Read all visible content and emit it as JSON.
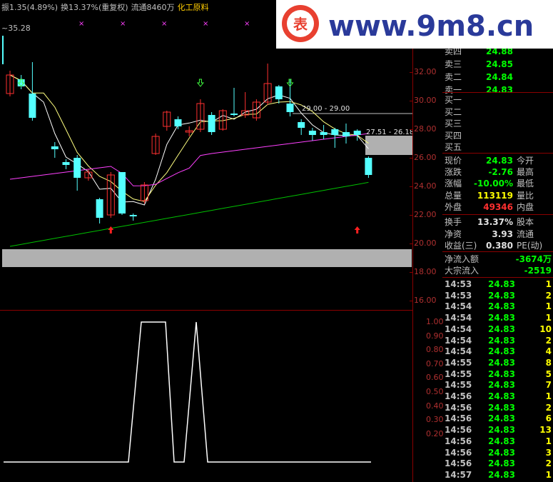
{
  "header": {
    "amplitude": "振1.35(4.89%)",
    "turnover": "换13.37%(重复权)",
    "float": "流通8460万",
    "sector": "化工原料",
    "price_marker": "~35.28"
  },
  "watermark": {
    "text": "www.9m8.cn",
    "seal": "表"
  },
  "chart_data": {
    "type": "candlestick",
    "price_axis": [
      "32.00",
      "30.00",
      "28.00",
      "26.00",
      "24.00",
      "22.00",
      "20.00",
      "18.00",
      "16.00"
    ],
    "annotations": [
      "29.00 - 29.00",
      "27.51 - 26.18"
    ],
    "indicator_axis": [
      "1.00",
      "0.90",
      "0.80",
      "0.70",
      "0.60",
      "0.50",
      "0.40",
      "0.30",
      "0.20"
    ],
    "candles": [
      {
        "o": 30.5,
        "c": 31.8,
        "h": 32.1,
        "l": 30.3
      },
      {
        "o": 31.5,
        "c": 31.0,
        "h": 31.8,
        "l": 30.8
      },
      {
        "o": 30.5,
        "c": 28.8,
        "h": 32.7,
        "l": 28.6
      },
      {
        "o": null,
        "c": null
      },
      {
        "o": 26.8,
        "c": 26.6,
        "h": 27.1,
        "l": 26.0
      },
      {
        "o": 25.7,
        "c": 25.5,
        "h": 25.9,
        "l": 25.2
      },
      {
        "o": 26.0,
        "c": 24.6,
        "h": 26.2,
        "l": 23.7
      },
      {
        "o": 24.6,
        "c": 25.0,
        "h": 25.2,
        "l": 24.4
      },
      {
        "o": 23.1,
        "c": 21.8,
        "h": 23.2,
        "l": 21.4
      },
      {
        "o": 22.0,
        "c": 24.8,
        "h": 25.0,
        "l": 21.8
      },
      {
        "o": 25.0,
        "c": 22.1,
        "h": 25.0,
        "l": 22.0
      },
      {
        "o": 22.0,
        "c": 21.9,
        "h": 22.1,
        "l": 21.6
      },
      {
        "o": 23.0,
        "c": 24.1,
        "h": 24.3,
        "l": 22.8
      },
      {
        "o": 26.3,
        "c": 27.5,
        "h": 27.7,
        "l": 26.2
      },
      {
        "o": 28.2,
        "c": 29.2,
        "h": 29.3,
        "l": 27.9
      },
      {
        "o": 28.7,
        "c": 28.2,
        "h": 28.9,
        "l": 28.0
      },
      {
        "o": 27.8,
        "c": 27.9,
        "h": 28.2,
        "l": 27.5
      },
      {
        "o": 28.0,
        "c": 29.8,
        "h": 30.1,
        "l": 27.8
      },
      {
        "o": 29.0,
        "c": 27.8,
        "h": 29.2,
        "l": 27.6
      },
      {
        "o": 28.0,
        "c": 29.3,
        "h": 29.4,
        "l": 27.9
      },
      {
        "o": 29.1,
        "c": 29.0,
        "h": 30.9,
        "l": 28.9
      },
      {
        "o": 29.0,
        "c": 29.3,
        "h": 30.6,
        "l": 28.8
      },
      {
        "o": 28.8,
        "c": 29.9,
        "h": 30.1,
        "l": 28.6
      },
      {
        "o": 29.9,
        "c": 31.2,
        "h": 32.6,
        "l": 29.7
      },
      {
        "o": 31.0,
        "c": 30.1,
        "h": 31.1,
        "l": 29.8
      },
      {
        "o": 29.8,
        "c": 29.2,
        "h": 31.5,
        "l": 28.9
      },
      {
        "o": 28.5,
        "c": 28.1,
        "h": 28.7,
        "l": 27.6
      },
      {
        "o": 27.9,
        "c": 27.6,
        "h": 28.1,
        "l": 27.2
      },
      {
        "o": 27.8,
        "c": 27.6,
        "h": 28.3,
        "l": 27.3
      },
      {
        "o": 28.0,
        "c": 27.6,
        "h": 28.1,
        "l": 26.7
      },
      {
        "o": 27.8,
        "c": 27.5,
        "h": 28.4,
        "l": 27.0
      },
      {
        "o": 27.9,
        "c": 27.6,
        "h": 28.0,
        "l": 27.2
      },
      {
        "o": 26.0,
        "c": 24.8,
        "h": 26.1,
        "l": 24.6
      }
    ]
  },
  "quote": {
    "sell": [
      {
        "label": "卖四",
        "price": "24.88"
      },
      {
        "label": "卖三",
        "price": "24.85"
      },
      {
        "label": "卖二",
        "price": "24.84"
      },
      {
        "label": "卖一",
        "price": "24.83"
      }
    ],
    "buy": [
      {
        "label": "买一"
      },
      {
        "label": "买二"
      },
      {
        "label": "买三"
      },
      {
        "label": "买四"
      },
      {
        "label": "买五"
      }
    ],
    "stats": [
      {
        "label": "现价",
        "value": "24.83",
        "label2": "今开",
        "color": "#00ff00"
      },
      {
        "label": "涨跌",
        "value": "-2.76",
        "label2": "最高",
        "color": "#00ff00"
      },
      {
        "label": "涨幅",
        "value": "-10.00%",
        "label2": "最低",
        "color": "#00ff00"
      },
      {
        "label": "总量",
        "value": "113119",
        "label2": "量比",
        "color": "#ffff00"
      },
      {
        "label": "外盘",
        "value": "49346",
        "label2": "内盘",
        "color": "#ff3030"
      }
    ],
    "stats2": [
      {
        "label": "换手",
        "value": "13.37%",
        "label2": "股本",
        "color": "#e0e0e0"
      },
      {
        "label": "净资",
        "value": "3.93",
        "label2": "流通",
        "color": "#e0e0e0"
      },
      {
        "label": "收益(三)",
        "value": "0.380",
        "label2": "PE(动)",
        "color": "#e0e0e0"
      }
    ],
    "flow": [
      {
        "label": "净流入额",
        "value": "-3674万"
      },
      {
        "label": "大宗流入",
        "value": "-2519"
      }
    ]
  },
  "ticks": [
    {
      "t": "14:53",
      "p": "24.83",
      "v": "1"
    },
    {
      "t": "14:53",
      "p": "24.83",
      "v": "2"
    },
    {
      "t": "14:54",
      "p": "24.83",
      "v": "1"
    },
    {
      "t": "14:54",
      "p": "24.83",
      "v": "1"
    },
    {
      "t": "14:54",
      "p": "24.83",
      "v": "10"
    },
    {
      "t": "14:54",
      "p": "24.83",
      "v": "2"
    },
    {
      "t": "14:54",
      "p": "24.83",
      "v": "4"
    },
    {
      "t": "14:55",
      "p": "24.83",
      "v": "8"
    },
    {
      "t": "14:55",
      "p": "24.83",
      "v": "5"
    },
    {
      "t": "14:55",
      "p": "24.83",
      "v": "7"
    },
    {
      "t": "14:56",
      "p": "24.83",
      "v": "1"
    },
    {
      "t": "14:56",
      "p": "24.83",
      "v": "2"
    },
    {
      "t": "14:56",
      "p": "24.83",
      "v": "6"
    },
    {
      "t": "14:56",
      "p": "24.83",
      "v": "13"
    },
    {
      "t": "14:56",
      "p": "24.83",
      "v": "1"
    },
    {
      "t": "14:56",
      "p": "24.83",
      "v": "3"
    },
    {
      "t": "14:56",
      "p": "24.83",
      "v": "2"
    },
    {
      "t": "14:57",
      "p": "24.83",
      "v": "1"
    }
  ],
  "colors": {
    "up": "#ff3030",
    "down": "#54ffff",
    "ma5": "#ffffff",
    "ma10": "#ffff80",
    "ma20": "#ff40ff",
    "ma60": "#00c000",
    "grid": "#8b0000"
  }
}
